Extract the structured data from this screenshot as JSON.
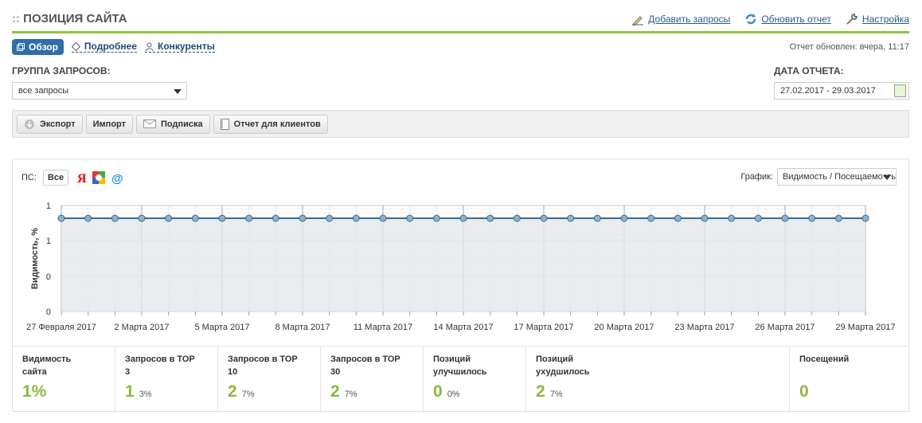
{
  "header": {
    "title": "ПОЗИЦИЯ САЙТА",
    "prefix": "::",
    "add_queries": "Добавить запросы",
    "refresh": "Обновить отчет",
    "settings": "Настройка"
  },
  "tabs": {
    "overview": "Обзор",
    "details": "Подробнее",
    "competitors": "Конкуренты"
  },
  "updated": "Отчет обновлен: вчера, 11:17",
  "group": {
    "label": "ГРУППА ЗАПРОСОВ:",
    "value": "все запросы"
  },
  "report_date": {
    "label": "ДАТА ОТЧЕТА:",
    "value": "27.02.2017 - 29.03.2017"
  },
  "toolbar": {
    "export": "Экспорт",
    "import": "Импорт",
    "subscribe": "Подписка",
    "client_report": "Отчет для клиентов"
  },
  "ps": {
    "label": "ПС:",
    "all": "Все"
  },
  "graph": {
    "label": "График:",
    "value": "Видимость / Посещаемость"
  },
  "chart_data": {
    "type": "line",
    "ylabel": "Видимость, %",
    "y_ticks": [
      "1",
      "1",
      "0",
      "0"
    ],
    "x_ticks": [
      "27 Февраля 2017",
      "2 Марта 2017",
      "5 Марта 2017",
      "8 Марта 2017",
      "11 Марта 2017",
      "14 Марта 2017",
      "17 Марта 2017",
      "20 Марта 2017",
      "23 Марта 2017",
      "26 Марта 2017",
      "29 Марта 2017"
    ],
    "series": [
      {
        "values": [
          1,
          1,
          1,
          1,
          1,
          1,
          1,
          1,
          1,
          1,
          1,
          1,
          1,
          1,
          1,
          1,
          1,
          1,
          1,
          1,
          1,
          1,
          1,
          1,
          1,
          1,
          1,
          1,
          1,
          1,
          1
        ]
      }
    ],
    "colors": {
      "line": "#3d6a8f",
      "fill": "#e3e8ec",
      "marker": "#8db0cc"
    }
  },
  "stats": [
    {
      "title": "Видимость сайта",
      "value": "1%",
      "pct": ""
    },
    {
      "title": "Запросов в ТОР 3",
      "value": "1",
      "pct": "3%"
    },
    {
      "title": "Запросов в ТОР 10",
      "value": "2",
      "pct": "7%"
    },
    {
      "title": "Запросов в ТОР 30",
      "value": "2",
      "pct": "7%"
    },
    {
      "title": "Позиций улучшилось",
      "value": "0",
      "pct": "0%"
    },
    {
      "title": "Позиций ухудшилось",
      "value": "2",
      "pct": "7%"
    },
    {
      "title": "Посещений",
      "value": "0",
      "pct": ""
    }
  ]
}
